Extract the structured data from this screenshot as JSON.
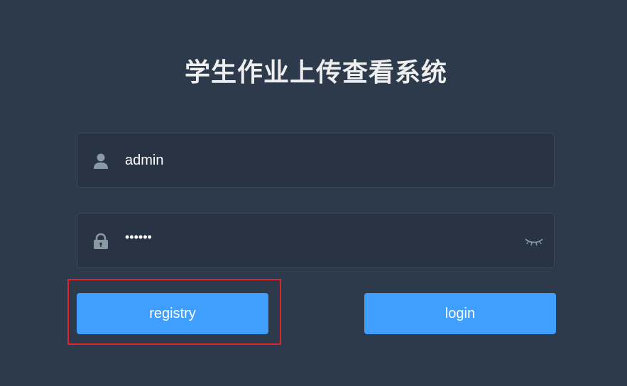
{
  "title": "学生作业上传查看系统",
  "username": {
    "value": "admin",
    "icon": "user-icon"
  },
  "password": {
    "value": "••••••",
    "icon": "lock-icon",
    "toggle_icon": "eye-closed-icon"
  },
  "buttons": {
    "registry": "registry",
    "login": "login"
  },
  "colors": {
    "background": "#2d3a4b",
    "field_background": "#283443",
    "button": "#409eff",
    "highlight": "#e0252a"
  }
}
